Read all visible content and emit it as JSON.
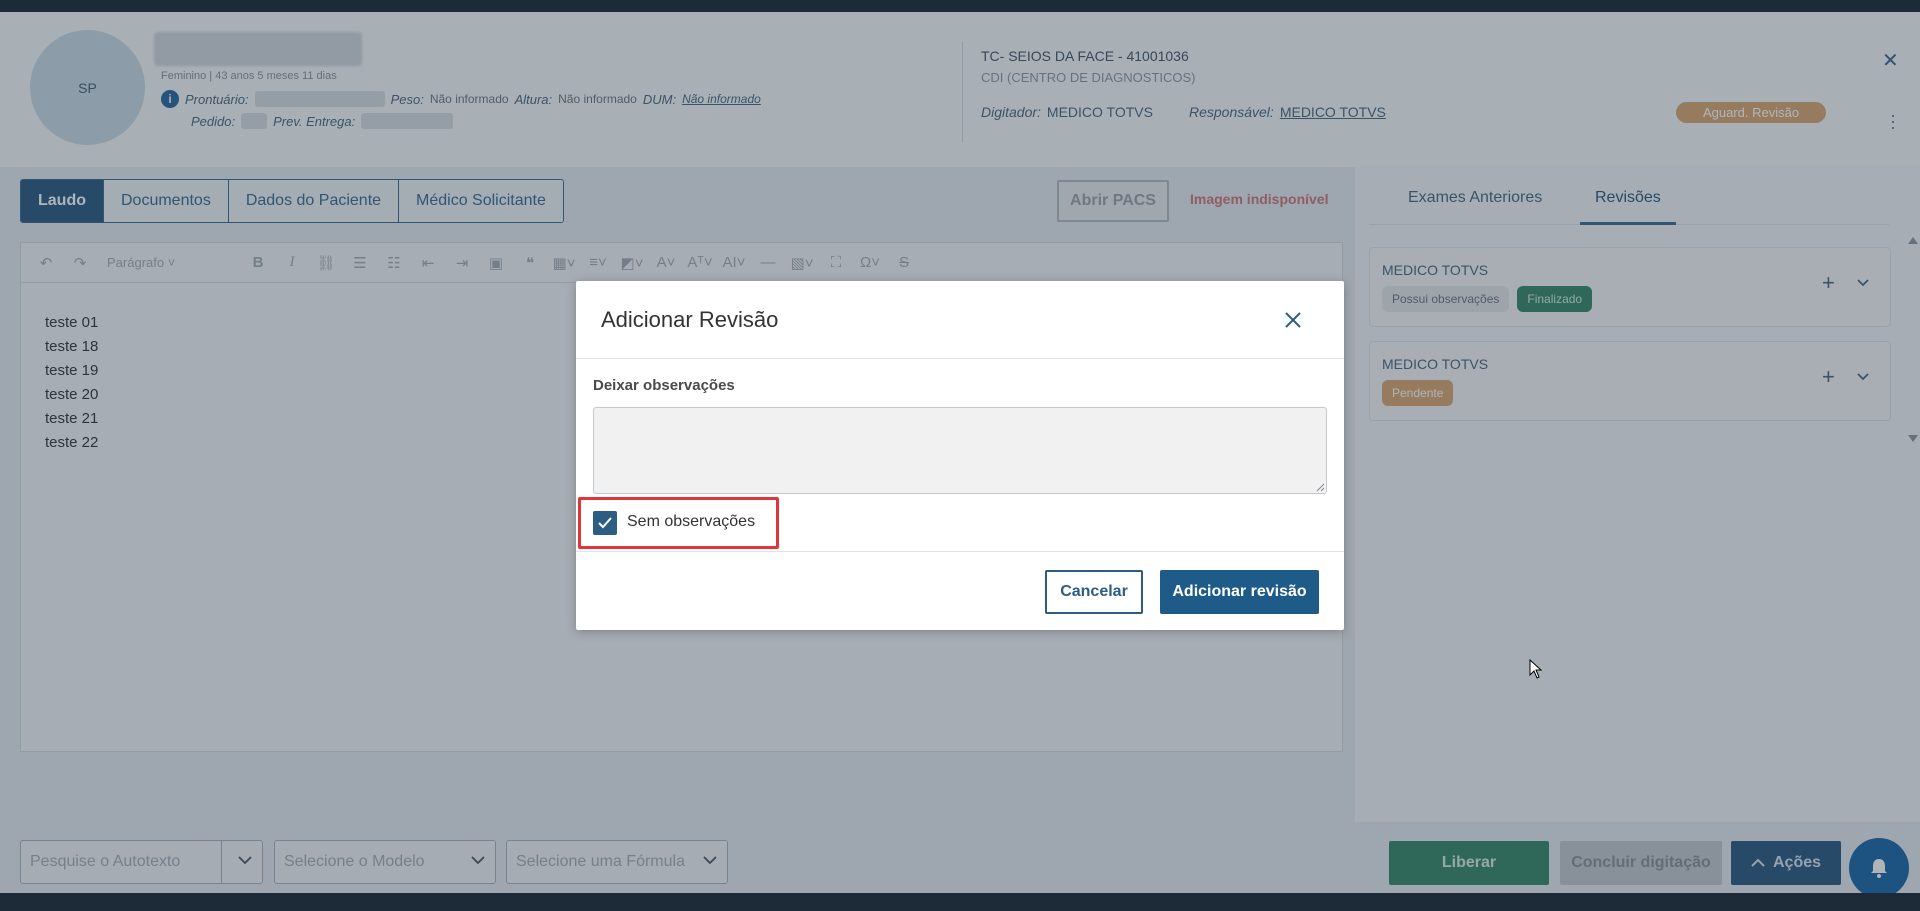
{
  "header": {
    "avatar_initials": "SP",
    "patient_info": "Feminino | 43 anos 5 meses 11 dias",
    "prontuario_label": "Prontuário:",
    "peso_label": "Peso:",
    "peso_value": "Não informado",
    "altura_label": "Altura:",
    "altura_value": "Não informado",
    "dum_label": "DUM:",
    "dum_value": "Não informado",
    "pedido_label": "Pedido:",
    "prev_entrega_label": "Prev. Entrega:",
    "exam_title": "TC- SEIOS DA FACE - 41001036",
    "exam_unit": "CDI (CENTRO DE DIAGNOSTICOS)",
    "digitador_label": "Digitador:",
    "digitador_value": "MEDICO TOTVS",
    "responsavel_label": "Responsável:",
    "responsavel_value": "MEDICO TOTVS",
    "status": "Aguard. Revisão"
  },
  "tabs": [
    {
      "label": "Laudo",
      "active": true
    },
    {
      "label": "Documentos",
      "active": false
    },
    {
      "label": "Dados do Paciente",
      "active": false
    },
    {
      "label": "Médico Solicitante",
      "active": false
    }
  ],
  "actions": {
    "abrir_pacs": "Abrir PACS",
    "image_unavailable": "Imagem indisponível"
  },
  "editor": {
    "paragraph_style": "Parágrafo",
    "lines": [
      "teste 01",
      "teste 18",
      "teste 19",
      "teste 20",
      "teste 21",
      "teste 22"
    ]
  },
  "footer": {
    "autotexto_placeholder": "Pesquise o Autotexto",
    "modelo_placeholder": "Selecione o Modelo",
    "formula_placeholder": "Selecione uma Fórmula",
    "liberar": "Liberar",
    "concluir": "Concluir digitação",
    "acoes": "Ações"
  },
  "right_panel": {
    "tabs": [
      {
        "label": "Exames Anteriores",
        "active": false
      },
      {
        "label": "Revisões",
        "active": true
      }
    ],
    "reviews": [
      {
        "name": "MEDICO TOTVS",
        "badges": [
          "Possui observações",
          "Finalizado"
        ]
      },
      {
        "name": "MEDICO TOTVS",
        "badges": [
          "Pendente"
        ]
      }
    ]
  },
  "modal": {
    "title": "Adicionar Revisão",
    "field_label": "Deixar observações",
    "textarea_value": "",
    "checkbox_label": "Sem observações",
    "checkbox_checked": true,
    "cancel": "Cancelar",
    "submit": "Adicionar revisão"
  },
  "colors": {
    "primary": "#2e5d84",
    "success": "#3b8a6a",
    "warning": "#dba873",
    "highlight": "#e0353b"
  }
}
